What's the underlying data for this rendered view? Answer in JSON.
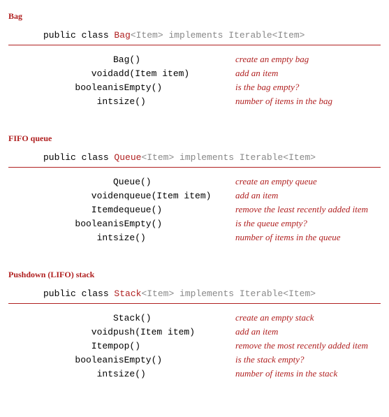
{
  "sections": [
    {
      "title": "Bag",
      "class_decl": {
        "prefix": "public class ",
        "name": "Bag",
        "generic": "<Item>",
        "suffix": " implements Iterable<Item>"
      },
      "methods": [
        {
          "ret": "",
          "sig": "Bag()",
          "desc": "create an empty bag"
        },
        {
          "ret": "void",
          "sig": "add(Item item)",
          "desc": "add an item"
        },
        {
          "ret": "boolean",
          "sig": "isEmpty()",
          "desc": "is the bag empty?"
        },
        {
          "ret": "int",
          "sig": "size()",
          "desc": "number of items in the bag"
        }
      ]
    },
    {
      "title": "FIFO queue",
      "class_decl": {
        "prefix": "public class ",
        "name": "Queue",
        "generic": "<Item>",
        "suffix": " implements Iterable<Item>"
      },
      "methods": [
        {
          "ret": "",
          "sig": "Queue()",
          "desc": "create an empty queue"
        },
        {
          "ret": "void",
          "sig": "enqueue(Item item)",
          "desc": "add an item"
        },
        {
          "ret": "Item",
          "sig": "dequeue()",
          "desc": "remove the least recently added item"
        },
        {
          "ret": "boolean",
          "sig": "isEmpty()",
          "desc": "is the queue empty?"
        },
        {
          "ret": "int",
          "sig": "size()",
          "desc": "number of items in the queue"
        }
      ]
    },
    {
      "title": "Pushdown (LIFO) stack",
      "class_decl": {
        "prefix": "public class ",
        "name": "Stack",
        "generic": "<Item>",
        "suffix": " implements Iterable<Item>"
      },
      "methods": [
        {
          "ret": "",
          "sig": "Stack()",
          "desc": "create an empty stack"
        },
        {
          "ret": "void",
          "sig": "push(Item item)",
          "desc": "add an item"
        },
        {
          "ret": "Item",
          "sig": "pop()",
          "desc": "remove the most recently added item"
        },
        {
          "ret": "boolean",
          "sig": "isEmpty()",
          "desc": "is the stack empty?"
        },
        {
          "ret": "int",
          "sig": "size()",
          "desc": "number of items in the stack"
        }
      ]
    }
  ]
}
